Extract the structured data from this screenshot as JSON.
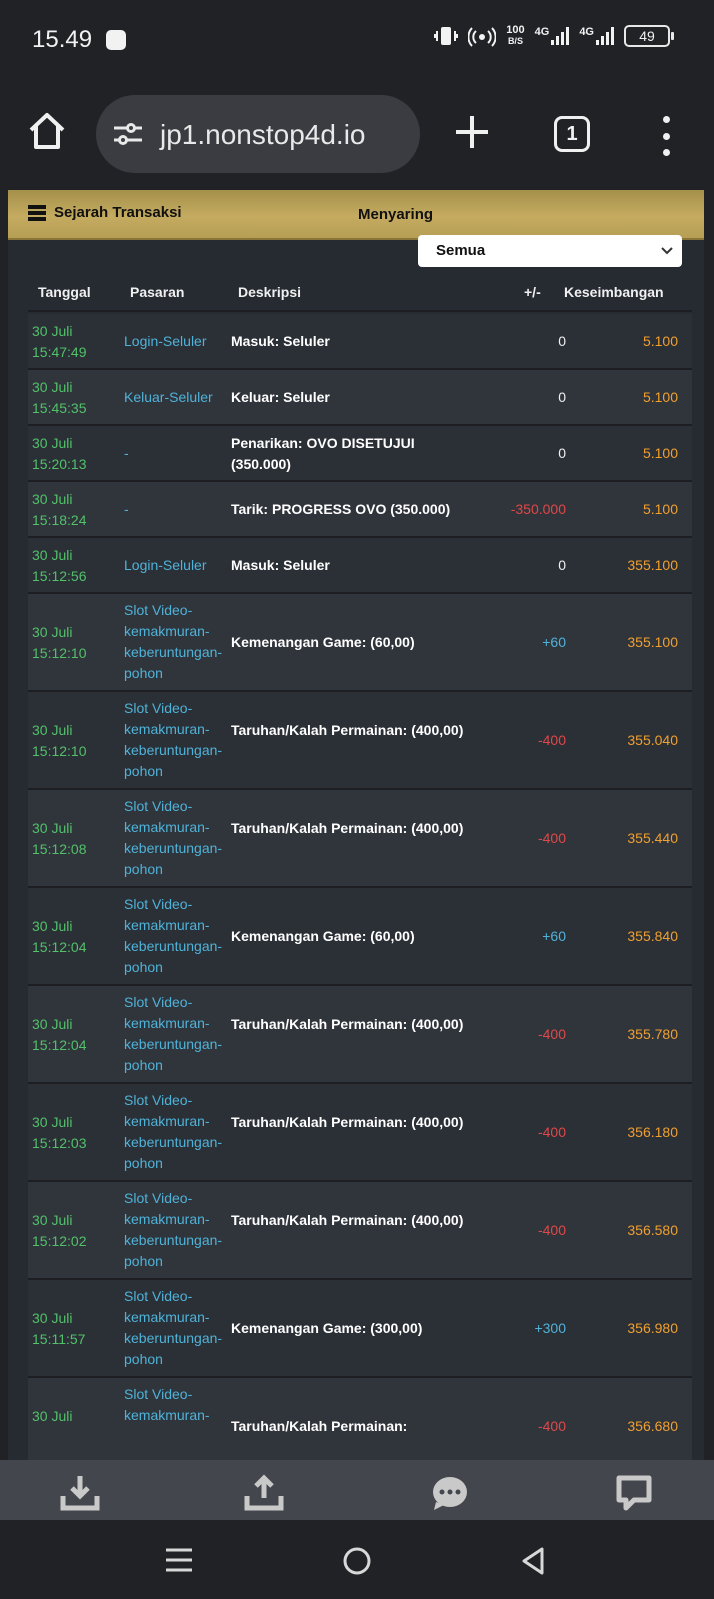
{
  "status": {
    "time": "15.49",
    "net_speed_top": "100",
    "net_speed_bottom": "B/S",
    "net1": "4G",
    "net2": "4G",
    "battery": "49"
  },
  "browser": {
    "url": "jp1.nonstop4d.io",
    "tab_count": "1"
  },
  "panel": {
    "title": "Sejarah Transaksi",
    "filter_label": "Menyaring",
    "filter_value": "Semua"
  },
  "table": {
    "headers": {
      "date": "Tanggal",
      "market": "Pasaran",
      "desc": "Deskripsi",
      "amount": "+/-",
      "balance": "Keseimbangan"
    },
    "rows": [
      {
        "date": "30 Juli",
        "time": "15:47:49",
        "market": "Login-Seluler",
        "desc": "Masuk: Seluler",
        "amount": "0",
        "amount_type": "zero",
        "balance": "5.100"
      },
      {
        "date": "30 Juli",
        "time": "15:45:35",
        "market": "Keluar-Seluler",
        "desc": "Keluar: Seluler",
        "amount": "0",
        "amount_type": "zero",
        "balance": "5.100"
      },
      {
        "date": "30 Juli",
        "time": "15:20:13",
        "market": "-",
        "desc": "Penarikan: OVO DISETUJUI (350.000)",
        "amount": "0",
        "amount_type": "zero",
        "balance": "5.100"
      },
      {
        "date": "30 Juli",
        "time": "15:18:24",
        "market": "-",
        "desc": "Tarik: PROGRESS OVO (350.000)",
        "amount": "-350.000",
        "amount_type": "neg",
        "balance": "5.100"
      },
      {
        "date": "30 Juli",
        "time": "15:12:56",
        "market": "Login-Seluler",
        "desc": "Masuk: Seluler",
        "amount": "0",
        "amount_type": "zero",
        "balance": "355.100"
      },
      {
        "date": "30 Juli",
        "time": "15:12:10",
        "market": "Slot Video-kemakmuran-keberuntungan-pohon",
        "desc": "Kemenangan Game: (60,00)",
        "amount": "+60",
        "amount_type": "pos",
        "balance": "355.100"
      },
      {
        "date": "30 Juli",
        "time": "15:12:10",
        "market": "Slot Video-kemakmuran-keberuntungan-pohon",
        "desc": "Taruhan/Kalah Permainan: (400,00)",
        "amount": "-400",
        "amount_type": "neg",
        "balance": "355.040"
      },
      {
        "date": "30 Juli",
        "time": "15:12:08",
        "market": "Slot Video-kemakmuran-keberuntungan-pohon",
        "desc": "Taruhan/Kalah Permainan: (400,00)",
        "amount": "-400",
        "amount_type": "neg",
        "balance": "355.440"
      },
      {
        "date": "30 Juli",
        "time": "15:12:04",
        "market": "Slot Video-kemakmuran-keberuntungan-pohon",
        "desc": "Kemenangan Game: (60,00)",
        "amount": "+60",
        "amount_type": "pos",
        "balance": "355.840"
      },
      {
        "date": "30 Juli",
        "time": "15:12:04",
        "market": "Slot Video-kemakmuran-keberuntungan-pohon",
        "desc": "Taruhan/Kalah Permainan: (400,00)",
        "amount": "-400",
        "amount_type": "neg",
        "balance": "355.780"
      },
      {
        "date": "30 Juli",
        "time": "15:12:03",
        "market": "Slot Video-kemakmuran-keberuntungan-pohon",
        "desc": "Taruhan/Kalah Permainan: (400,00)",
        "amount": "-400",
        "amount_type": "neg",
        "balance": "356.180"
      },
      {
        "date": "30 Juli",
        "time": "15:12:02",
        "market": "Slot Video-kemakmuran-keberuntungan-pohon",
        "desc": "Taruhan/Kalah Permainan: (400,00)",
        "amount": "-400",
        "amount_type": "neg",
        "balance": "356.580"
      },
      {
        "date": "30 Juli",
        "time": "15:11:57",
        "market": "Slot Video-kemakmuran-keberuntungan-pohon",
        "desc": "Kemenangan Game: (300,00)",
        "amount": "+300",
        "amount_type": "pos",
        "balance": "356.980"
      },
      {
        "date": "30 Juli",
        "time": "",
        "market": "Slot Video-kemakmuran-",
        "desc": "Taruhan/Kalah Permainan:",
        "amount": "-400",
        "amount_type": "neg",
        "balance": "356.680"
      }
    ]
  },
  "bottom_bar": {
    "icons": [
      "download-icon",
      "upload-icon",
      "chat-icon",
      "message-icon"
    ]
  },
  "colors": {
    "date": "#52c16a",
    "market": "#4fb3d9",
    "balance": "#f0a030",
    "negative": "#e04848",
    "header_gold": "#c4ab60"
  }
}
